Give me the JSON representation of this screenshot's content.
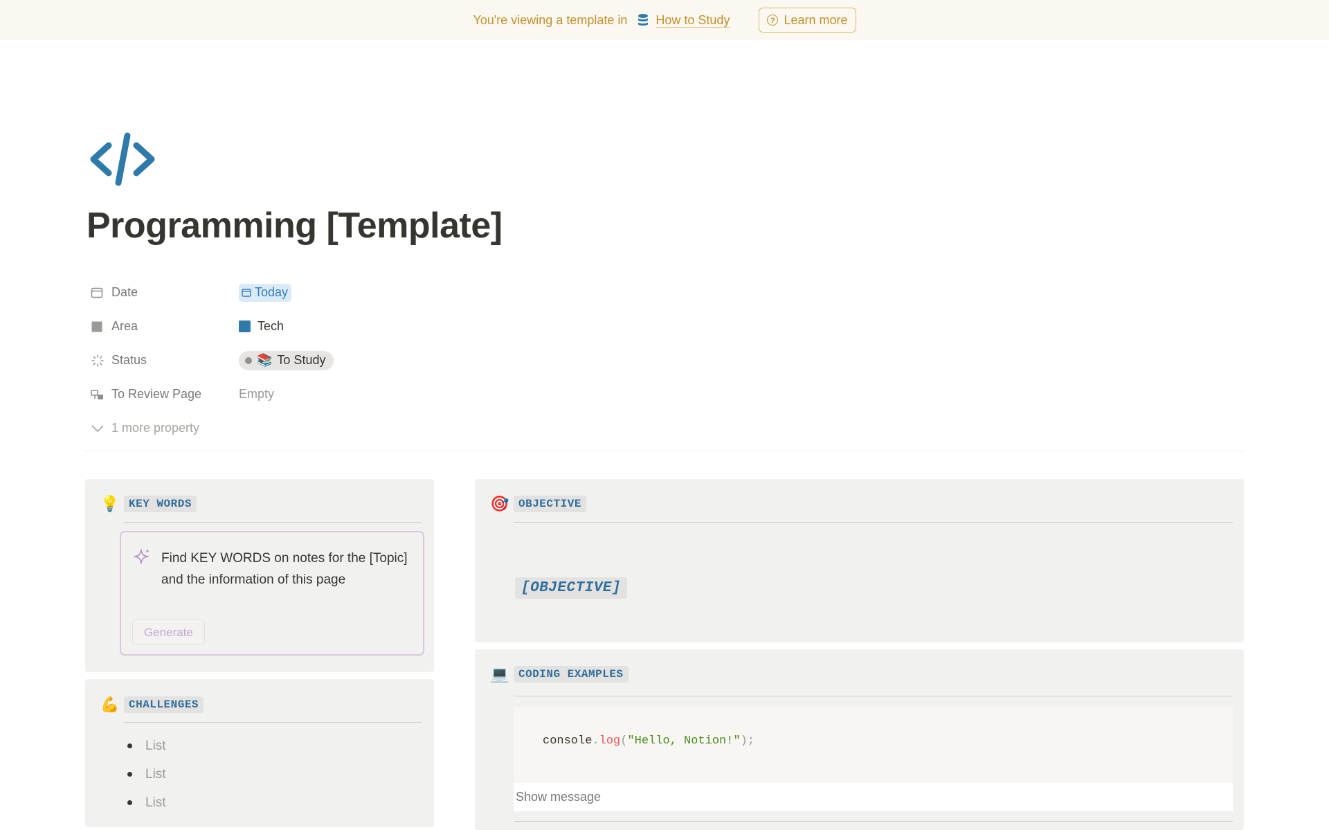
{
  "banner": {
    "message": "You're viewing a template in",
    "database_name": "How to Study",
    "learn_more": "Learn more",
    "color": "#c0912a"
  },
  "page": {
    "icon": "code-icon",
    "icon_color": "#2e7aaa",
    "title": "Programming [Template]"
  },
  "properties": {
    "date": {
      "label": "Date",
      "value": "Today"
    },
    "area": {
      "label": "Area",
      "value": "Tech",
      "color": "#2e7aaa"
    },
    "status": {
      "label": "Status",
      "emoji": "📚",
      "value": "To Study"
    },
    "review": {
      "label": "To Review Page",
      "value": "Empty"
    },
    "more": "1 more property"
  },
  "key_words": {
    "emoji": "💡",
    "heading": "KEY WORDS",
    "ai_prompt": "Find KEY WORDS on notes for the [Topic] and the information of this page",
    "generate": "Generate"
  },
  "challenges": {
    "emoji": "💪",
    "heading": "CHALLENGES",
    "items": [
      "List",
      "List",
      "List"
    ]
  },
  "objective": {
    "emoji": "🎯",
    "heading": "OBJECTIVE",
    "text": "[OBJECTIVE]"
  },
  "coding": {
    "emoji": "💻",
    "heading": "CODING EXAMPLES",
    "code": {
      "object": "console",
      "dot": ".",
      "method": "log",
      "open": "(",
      "string": "\"Hello, Notion!\"",
      "close": ");"
    },
    "caption": "Show message"
  }
}
